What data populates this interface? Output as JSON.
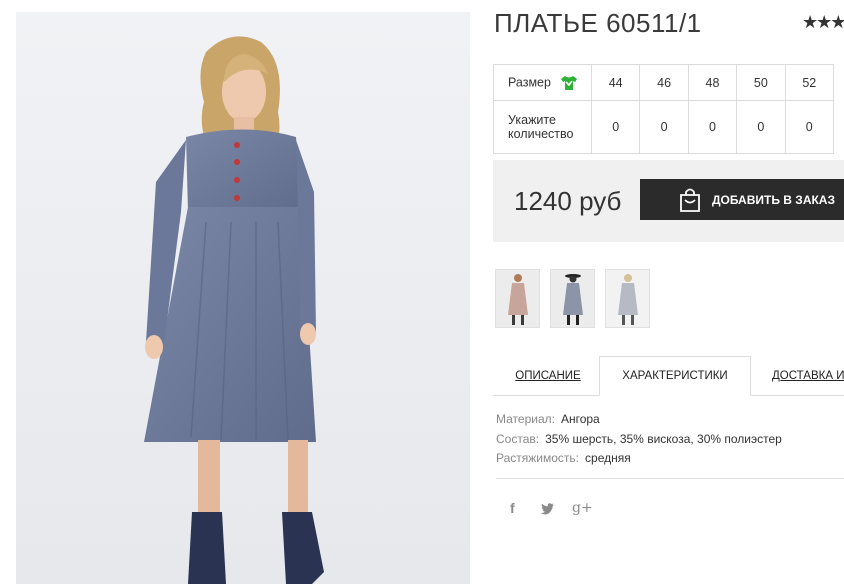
{
  "product": {
    "title": "ПЛАТЬЕ 60511/1",
    "rating_stars": "★★★"
  },
  "size_table": {
    "size_label": "Размер",
    "size_icon": "tshirt-icon",
    "sizes": [
      "44",
      "46",
      "48",
      "50",
      "52"
    ],
    "quantity_label_line1": "Укажите",
    "quantity_label_line2": "количество",
    "quantities": [
      "0",
      "0",
      "0",
      "0",
      "0"
    ]
  },
  "price": {
    "value": "1240 руб",
    "button_label": "ДОБАВИТЬ В ЗАКАЗ",
    "button_icon": "shopping-bag-icon"
  },
  "thumbnails": [
    "dress-pink-thumbnail",
    "dress-grey-hat-thumbnail",
    "dress-light-grey-thumbnail"
  ],
  "tabs": {
    "description": "ОПИСАНИЕ",
    "characteristics": "ХАРАКТЕРИСТИКИ",
    "delivery": "ДОСТАВКА И О"
  },
  "characteristics": {
    "material_label": "Материал:",
    "material_value": "Ангора",
    "composition_label": "Состав:",
    "composition_value": "35% шерсть, 35% вискоза, 30% полиэстер",
    "stretch_label": "Растяжимость:",
    "stretch_value": "средняя"
  },
  "social": {
    "facebook": "f",
    "twitter": "twitter-icon",
    "google_plus": "g+"
  },
  "colors": {
    "button_bg": "#2b2b2b",
    "price_bg": "#f0f0f0",
    "tshirt_green": "#2eb135",
    "dress_blue_grey": "#6f7d9c"
  }
}
